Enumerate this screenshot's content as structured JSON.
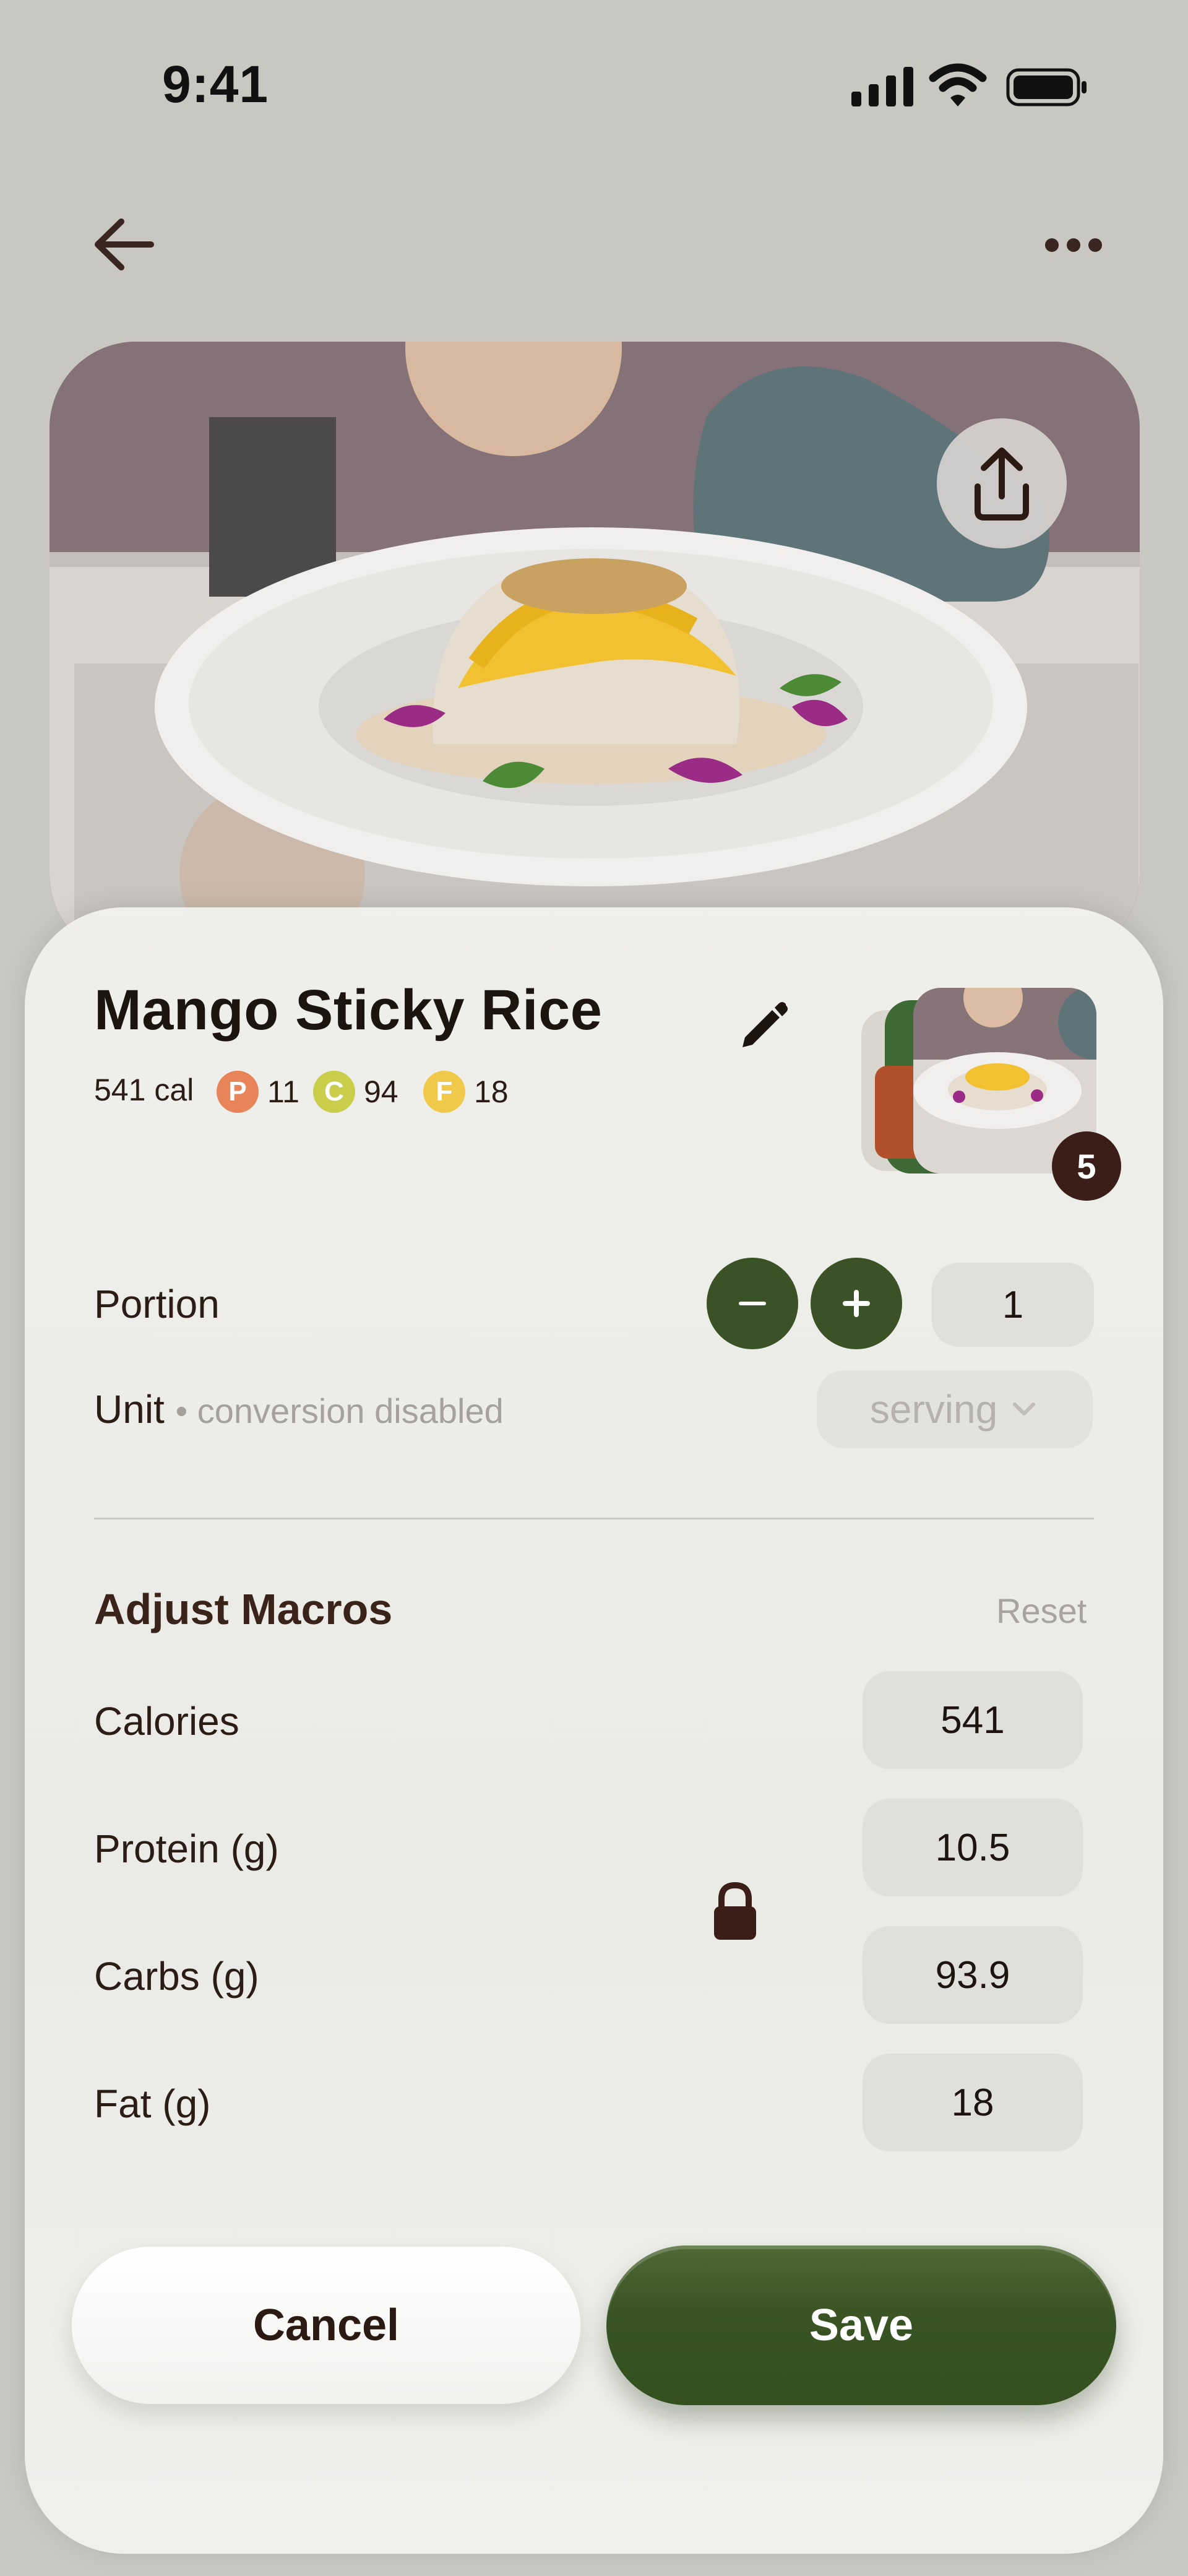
{
  "status_bar": {
    "time": "9:41"
  },
  "meal": {
    "title": "Mango Sticky Rice",
    "calories_label": "541 cal",
    "macros": [
      {
        "letter": "P",
        "value": "11",
        "color": "#e8845a"
      },
      {
        "letter": "C",
        "value": "94",
        "color": "#c9cf4a"
      },
      {
        "letter": "F",
        "value": "18",
        "color": "#f0c94a"
      }
    ],
    "photo_count": "5"
  },
  "portion": {
    "label": "Portion",
    "value": "1"
  },
  "unit": {
    "label": "Unit",
    "hint": "• conversion disabled",
    "selected": "serving"
  },
  "adjust": {
    "title": "Adjust Macros",
    "reset_label": "Reset",
    "rows": [
      {
        "label": "Calories",
        "value": "541"
      },
      {
        "label": "Protein (g)",
        "value": "10.5"
      },
      {
        "label": "Carbs (g)",
        "value": "93.9"
      },
      {
        "label": "Fat (g)",
        "value": "18"
      }
    ]
  },
  "actions": {
    "cancel": "Cancel",
    "save": "Save"
  },
  "icons": [
    "signal-icon",
    "wifi-icon",
    "battery-icon",
    "back-arrow-icon",
    "more-icon",
    "share-icon",
    "pencil-icon",
    "minus-icon",
    "plus-icon",
    "chevron-down-icon",
    "lock-icon"
  ],
  "colors": {
    "accent_green": "#3a5226",
    "badge_brown": "#3a1e17"
  }
}
